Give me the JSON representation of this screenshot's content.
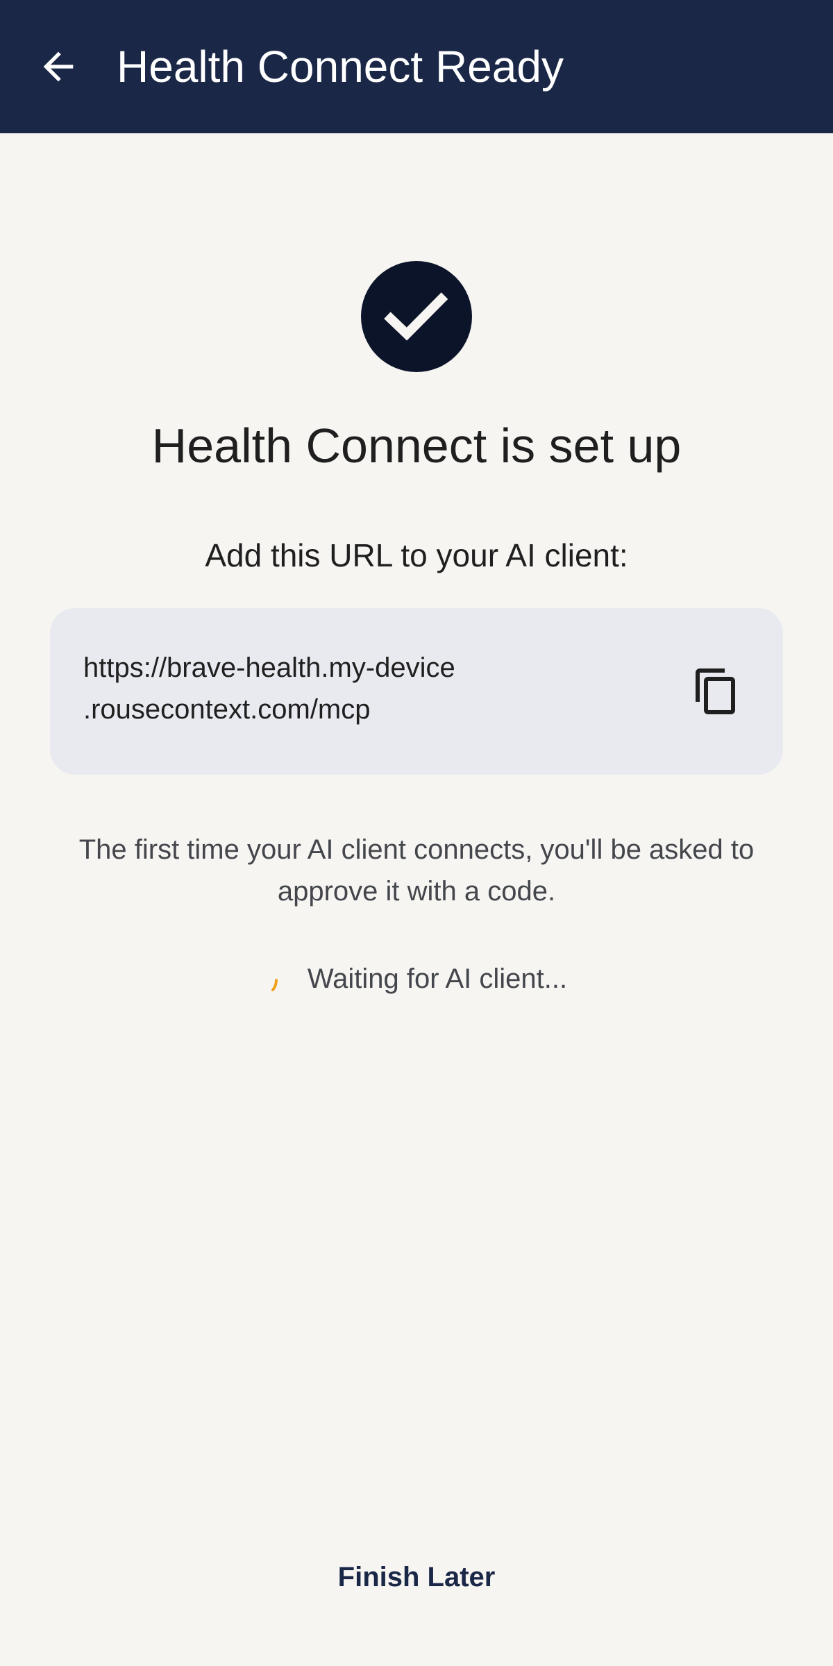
{
  "app_bar": {
    "title": "Health Connect Ready"
  },
  "icons": {
    "back": "arrow-left-icon",
    "status": "check-circle-icon",
    "copy": "copy-icon",
    "spinner": "progress-spinner-icon"
  },
  "main": {
    "headline": "Health Connect is set up",
    "instruction": "Add this URL to your AI client:",
    "url_line_1": "https://brave-health.my-device",
    "url_line_2": ".rousecontext.com/mcp",
    "helper_text": "The first time your AI client connects, you'll be asked to approve it with a code.",
    "status_text": "Waiting for AI client..."
  },
  "actions": {
    "finish_later_label": "Finish Later"
  },
  "colors": {
    "app_bar": "#1b2747",
    "badge": "#0b1428",
    "card": "#e9eaf0",
    "spinner": "#f2a21b",
    "background": "#f6f5f2"
  }
}
